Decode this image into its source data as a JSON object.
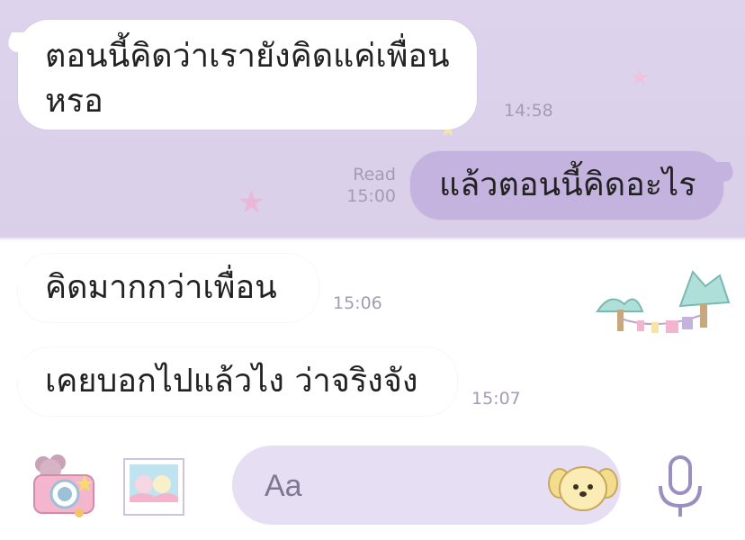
{
  "messages": [
    {
      "direction": "incoming",
      "text": "ตอนนี้คิดว่าเรายังคิดแค่เพื่อน หรอ",
      "time": "14:58"
    },
    {
      "direction": "outgoing",
      "text": "แล้วตอนนี้คิดอะไร",
      "status": "Read",
      "time": "15:00"
    },
    {
      "direction": "incoming",
      "text": "คิดมากกว่าเพื่อน",
      "time": "15:06"
    },
    {
      "direction": "incoming",
      "text": "เคยบอกไปแล้วไง ว่าจริงจัง",
      "time": "15:07"
    }
  ],
  "input_bar": {
    "placeholder": "Aa",
    "icons": [
      "camera-icon",
      "photo-album-icon",
      "sticker-dog-icon",
      "microphone-icon"
    ]
  },
  "colors": {
    "chat_background": "#ddd3ec",
    "outgoing_bubble": "#c4b3de",
    "incoming_bubble": "#ffffff",
    "input_field": "#e6def3",
    "timestamp": "#a49bb4"
  }
}
